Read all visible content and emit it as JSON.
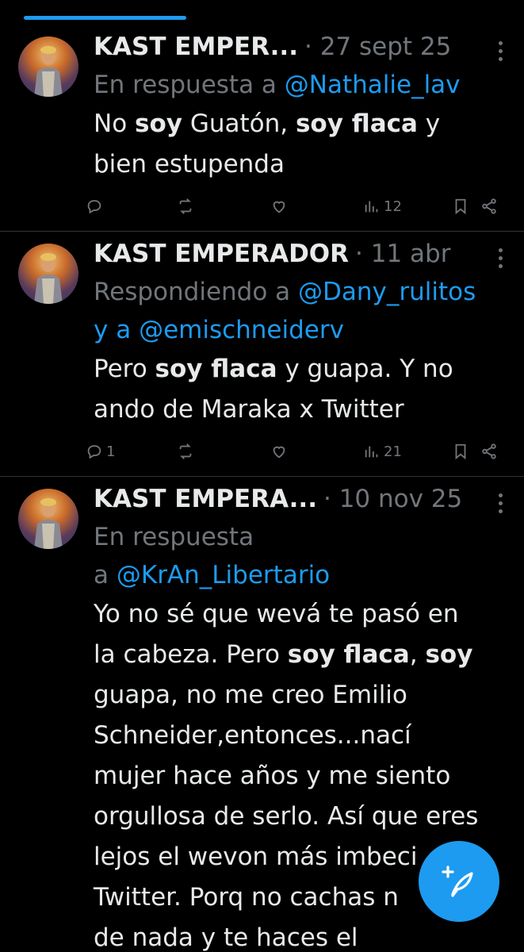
{
  "tweets": [
    {
      "name": "KAST EMPER...",
      "date": "27 sept 25",
      "reply_prefix": "En respuesta a ",
      "reply_handle1": "@Nathalie_lav",
      "line1": [
        "No ",
        "soy",
        " Guatón, ",
        "soy flaca",
        " y"
      ],
      "line2": "bien estupenda",
      "replies": "",
      "views": "12"
    },
    {
      "name": "KAST EMPERADOR",
      "date": "11 abr",
      "reply_prefix": "Respondiendo a ",
      "reply_handle1": "@Dany_rulitos",
      "reply_mid": "y a ",
      "reply_handle2": "@emischneiderv",
      "line1": [
        "Pero ",
        "soy flaca",
        " y guapa. Y no"
      ],
      "line2": "ando de Maraka x Twitter",
      "replies": "1",
      "views": "21"
    },
    {
      "name": "KAST EMPERA...",
      "date": "10 nov 25",
      "reply_prefix": "En respuesta",
      "reply_mid": "a ",
      "reply_handle1": "@KrAn_Libertario",
      "lines": [
        "Yo no sé que wevá te pasó en",
        "guapa, no me creo Emilio",
        "Schneider,entonces...nací",
        "mujer hace años y me siento",
        "orgullosa de serlo. Así que eres",
        "lejos el wevon más imbeci",
        "Twitter. Porq no cachas n",
        "de nada y te haces el"
      ],
      "line2_parts": [
        "la cabeza. Pero ",
        "soy flaca",
        ", ",
        "soy"
      ]
    }
  ],
  "icons": {
    "reply": "reply-icon",
    "retweet": "retweet-icon",
    "like": "heart-icon",
    "views": "views-icon",
    "bookmark": "bookmark-icon",
    "share": "share-icon",
    "compose": "compose-icon"
  },
  "colors": {
    "background": "#000000",
    "text": "#e7e9ea",
    "muted": "#71767b",
    "accent": "#1d9bf0"
  }
}
